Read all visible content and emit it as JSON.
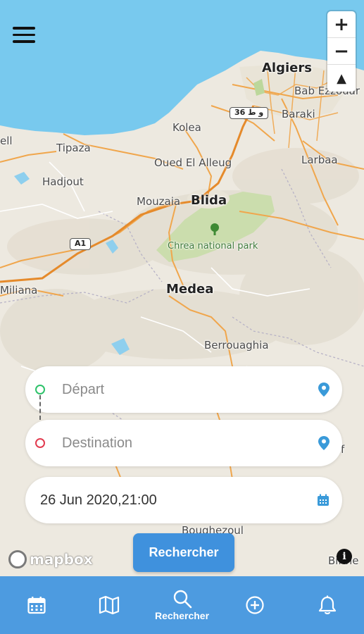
{
  "map": {
    "places": {
      "algiers": "Algiers",
      "bab_ezzouar": "Bab Ezzouar",
      "baraki": "Baraki",
      "kolea": "Kolea",
      "tipaza": "Tipaza",
      "hadjout": "Hadjout",
      "oued_el_alleug": "Oued El Alleug",
      "larbaa": "Larbaa",
      "blida": "Blida",
      "mouzaia": "Mouzaia",
      "chrea": "Chrea national park",
      "medea": "Medea",
      "miliana": "Miliana",
      "berrouaghia": "Berrouaghia",
      "boughezoul": "Boughezoul",
      "birine": "Birine",
      "cherchell": "ell",
      "f_edge": "f"
    },
    "road_shields": {
      "a1": "A1",
      "r36": "36 و ط"
    },
    "zoom_in": "+",
    "zoom_out": "−",
    "compass": "▲",
    "attribution": "mapbox",
    "info": "i"
  },
  "search": {
    "depart_placeholder": "Départ",
    "destination_placeholder": "Destination",
    "datetime": "26 Jun 2020,21:00",
    "button": "Rechercher"
  },
  "nav": {
    "items": [
      {
        "icon": "calendar-icon",
        "label": ""
      },
      {
        "icon": "map-icon",
        "label": ""
      },
      {
        "icon": "search-icon",
        "label": "Rechercher"
      },
      {
        "icon": "add-circle-icon",
        "label": ""
      },
      {
        "icon": "bell-icon",
        "label": ""
      }
    ]
  },
  "colors": {
    "accent": "#3f91dd",
    "nav_bg": "#4d9be0",
    "sea": "#78c9ee",
    "depart_dot": "#2ec26a",
    "destination_dot": "#e23b4f",
    "pin": "#3a9ad9"
  }
}
